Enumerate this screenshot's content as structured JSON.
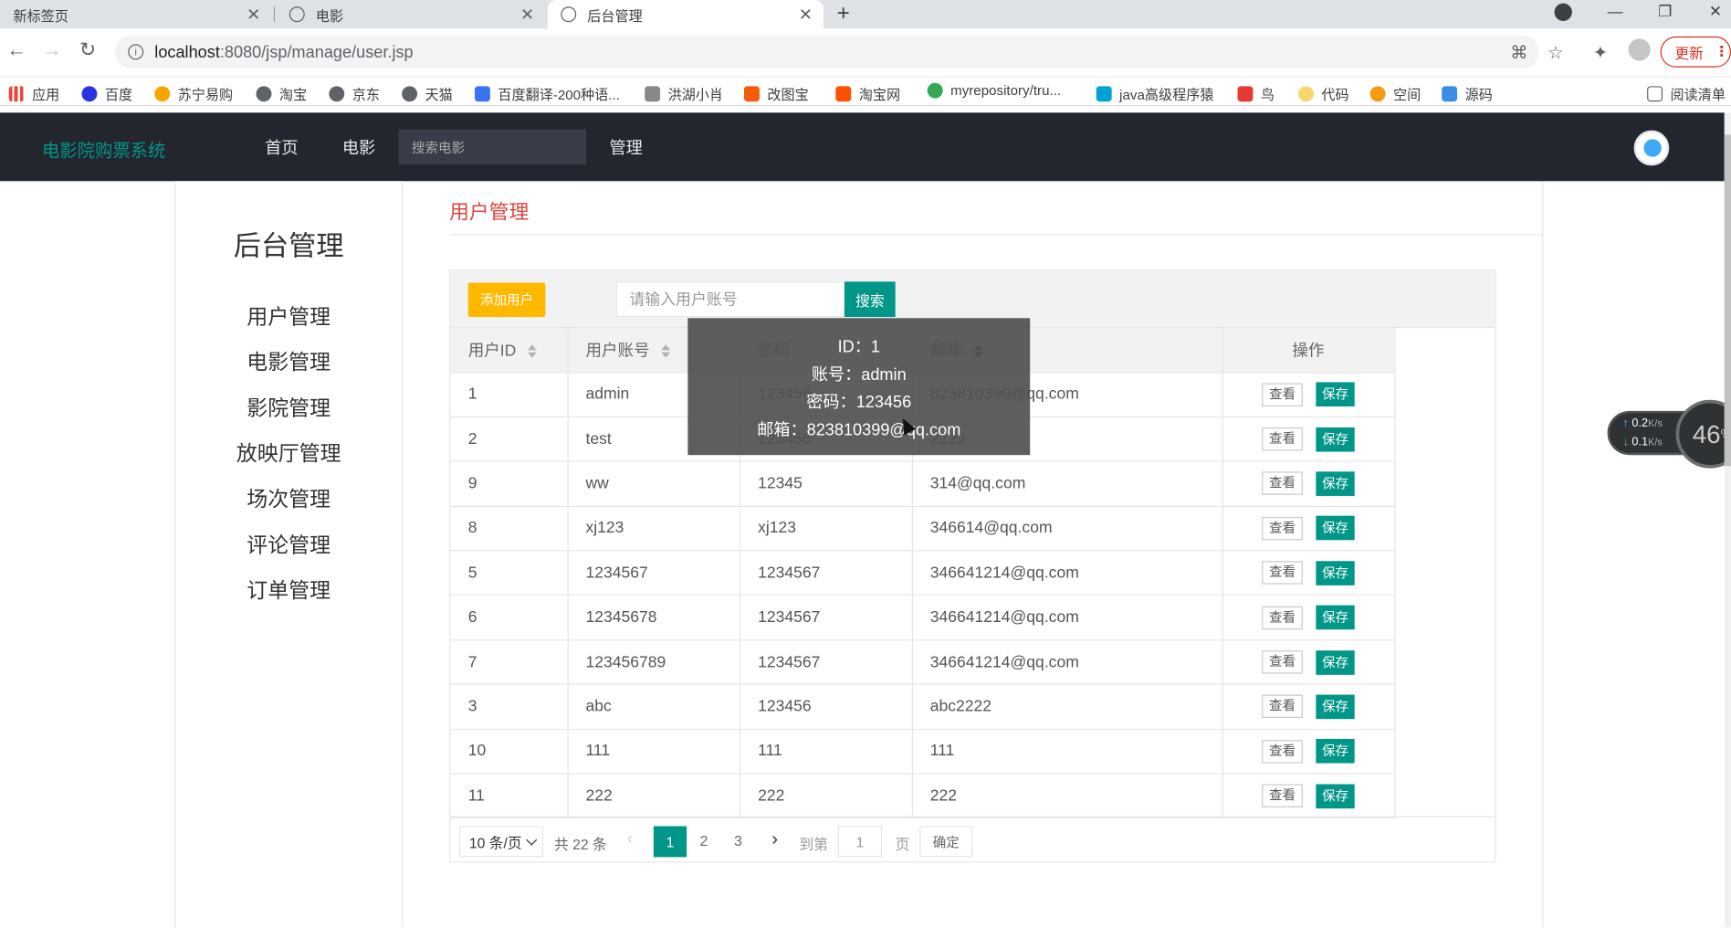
{
  "browser": {
    "tabs": [
      {
        "label": "新标签页"
      },
      {
        "label": "电影"
      },
      {
        "label": "后台管理"
      }
    ],
    "url_host": "localhost",
    "url_path": ":8080/jsp/manage/user.jsp",
    "update_label": "更新",
    "bookmarks": [
      {
        "label": "应用",
        "color": "#e8453c"
      },
      {
        "label": "百度",
        "color": "#2932e1"
      },
      {
        "label": "苏宁易购",
        "color": "#f7a600"
      },
      {
        "label": "淘宝",
        "color": "#5f6368"
      },
      {
        "label": "京东",
        "color": "#5f6368"
      },
      {
        "label": "天猫",
        "color": "#5f6368"
      },
      {
        "label": "百度翻译-200种语...",
        "color": "#3b74f2"
      },
      {
        "label": "洪湖小肖",
        "color": "#888"
      },
      {
        "label": "改图宝",
        "color": "#f25c05"
      },
      {
        "label": "淘宝网",
        "color": "#ff5000"
      },
      {
        "label": "myrepository/tru...",
        "color": "#34a853"
      },
      {
        "label": "java高级程序猿",
        "color": "#00a1d6"
      },
      {
        "label": "鸟",
        "color": "#e53935"
      },
      {
        "label": "代码",
        "color": "#f5d76e"
      },
      {
        "label": "空间",
        "color": "#f39c12"
      },
      {
        "label": "源码",
        "color": "#3a8ee6"
      }
    ],
    "reading_list": "阅读清单"
  },
  "app": {
    "brand": "电影院购票系统",
    "nav": [
      "首页",
      "电影"
    ],
    "nav_search_placeholder": "搜索电影",
    "nav_manage": "管理"
  },
  "sidebar": {
    "title": "后台管理",
    "items": [
      "用户管理",
      "电影管理",
      "影院管理",
      "放映厅管理",
      "场次管理",
      "评论管理",
      "订单管理"
    ]
  },
  "main": {
    "title": "用户管理",
    "add_button": "添加用户",
    "search_placeholder": "请输入用户账号",
    "search_button": "搜索",
    "columns": [
      "用户ID",
      "用户账号",
      "密码",
      "邮箱",
      "操作"
    ],
    "rows": [
      [
        "1",
        "admin",
        "123456",
        "823810399@qq.com"
      ],
      [
        "2",
        "test",
        "123456",
        "2222"
      ],
      [
        "9",
        "ww",
        "12345",
        "314@qq.com"
      ],
      [
        "8",
        "xj123",
        "xj123",
        "346614@qq.com"
      ],
      [
        "5",
        "1234567",
        "1234567",
        "346641214@qq.com"
      ],
      [
        "6",
        "12345678",
        "1234567",
        "346641214@qq.com"
      ],
      [
        "7",
        "123456789",
        "1234567",
        "346641214@qq.com"
      ],
      [
        "3",
        "abc",
        "123456",
        "abc2222"
      ],
      [
        "10",
        "111",
        "111",
        "111"
      ],
      [
        "11",
        "222",
        "222",
        "222"
      ]
    ],
    "view_label": "查看",
    "save_label": "保存",
    "pager": {
      "page_size": "10 条/页",
      "total": "共 22 条",
      "pages": [
        "1",
        "2",
        "3"
      ],
      "current": "1",
      "goto_label": "到第",
      "goto_value": "1",
      "page_unit": "页",
      "confirm": "确定"
    }
  },
  "tooltip": {
    "line1": "ID：1",
    "line2": "账号：admin",
    "line3": "密码：123456",
    "line4": "邮箱：823810399@qq.com"
  },
  "net_widget": {
    "up": "0.2",
    "down": "0.1",
    "unit": "K/s",
    "percent": "46",
    "percent_sign": "%"
  },
  "colors": {
    "accent": "#009688",
    "warn": "#ffb800",
    "title_red": "#e2423e",
    "nav_bg": "#23262e"
  }
}
